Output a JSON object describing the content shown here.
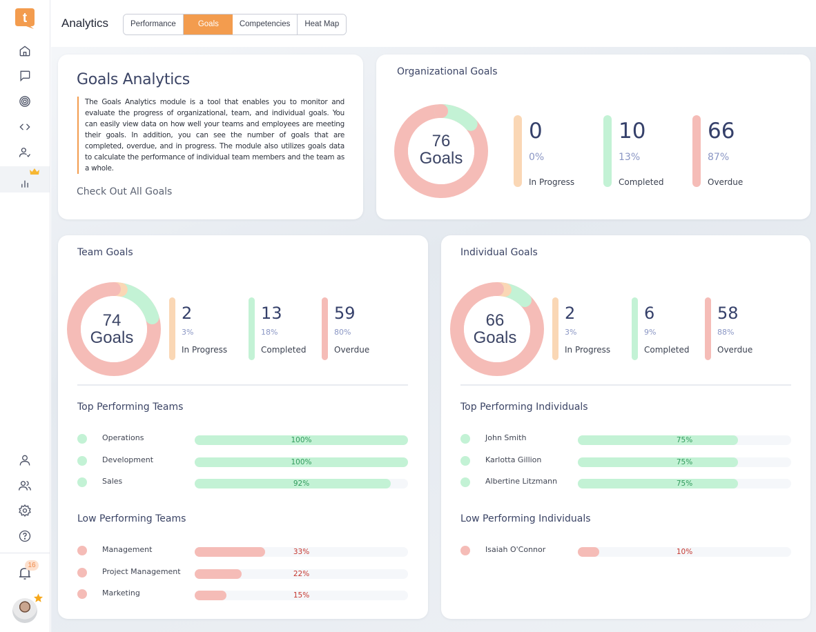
{
  "app": {
    "logo_letter": "t",
    "header_title": "Analytics",
    "tabs": [
      {
        "label": "Performance",
        "active": false
      },
      {
        "label": "Goals",
        "active": true
      },
      {
        "label": "Competencies",
        "active": false
      },
      {
        "label": "Heat Map",
        "active": false
      }
    ],
    "notifications_count": "16"
  },
  "sidebar": {
    "items": [
      {
        "name": "home",
        "icon": "home-icon"
      },
      {
        "name": "chat",
        "icon": "chat-icon"
      },
      {
        "name": "goals",
        "icon": "target-icon"
      },
      {
        "name": "code",
        "icon": "code-icon"
      },
      {
        "name": "user-check",
        "icon": "user-check-icon"
      },
      {
        "name": "analytics",
        "icon": "bar-chart-icon",
        "active": true,
        "badge": "crown-icon"
      }
    ],
    "bottom_items": [
      {
        "name": "profile",
        "icon": "user-icon"
      },
      {
        "name": "people",
        "icon": "users-icon"
      },
      {
        "name": "settings",
        "icon": "gear-icon"
      },
      {
        "name": "help",
        "icon": "help-icon"
      }
    ]
  },
  "colors": {
    "accent": "#f39c4e",
    "in_progress": "#fad7b5",
    "completed": "#c3f2d5",
    "overdue": "#f5bcb7",
    "number": "#35406a",
    "percent": "#8a96c4"
  },
  "intro": {
    "title": "Goals Analytics",
    "description": "The Goals Analytics module is a tool that enables you to monitor and evaluate the progress of organizational, team, and individual goals. You can easily view data on how well your teams and employees are meeting their goals. In addition, you can see the number of goals that are completed, overdue, and in progress. The module also utilizes goals data to calculate the performance of individual team members and the team as a whole.",
    "link": "Check Out All Goals"
  },
  "org": {
    "title": "Organizational Goals",
    "total": "76",
    "total_label": "Goals",
    "stats": [
      {
        "key": "in_progress",
        "value": 0,
        "display": "0",
        "percent": "0%",
        "label": "In Progress"
      },
      {
        "key": "completed",
        "value": 10,
        "display": "10",
        "percent": "13%",
        "label": "Completed"
      },
      {
        "key": "overdue",
        "value": 66,
        "display": "66",
        "percent": "87%",
        "label": "Overdue"
      }
    ]
  },
  "team": {
    "title": "Team Goals",
    "total": "74",
    "total_label": "Goals",
    "stats": [
      {
        "key": "in_progress",
        "value": 2,
        "display": "2",
        "percent": "3%",
        "label": "In Progress"
      },
      {
        "key": "completed",
        "value": 13,
        "display": "13",
        "percent": "18%",
        "label": "Completed"
      },
      {
        "key": "overdue",
        "value": 59,
        "display": "59",
        "percent": "80%",
        "label": "Overdue"
      }
    ],
    "top_title": "Top Performing Teams",
    "top": [
      {
        "name": "Operations",
        "value": 100,
        "label": "100%"
      },
      {
        "name": "Development",
        "value": 100,
        "label": "100%"
      },
      {
        "name": "Sales",
        "value": 92,
        "label": "92%"
      }
    ],
    "low_title": "Low Performing Teams",
    "low": [
      {
        "name": "Management",
        "value": 33,
        "label": "33%"
      },
      {
        "name": "Project Management",
        "value": 22,
        "label": "22%"
      },
      {
        "name": "Marketing",
        "value": 15,
        "label": "15%"
      }
    ]
  },
  "indiv": {
    "title": "Individual Goals",
    "total": "66",
    "total_label": "Goals",
    "stats": [
      {
        "key": "in_progress",
        "value": 2,
        "display": "2",
        "percent": "3%",
        "label": "In Progress"
      },
      {
        "key": "completed",
        "value": 6,
        "display": "6",
        "percent": "9%",
        "label": "Completed"
      },
      {
        "key": "overdue",
        "value": 58,
        "display": "58",
        "percent": "88%",
        "label": "Overdue"
      }
    ],
    "top_title": "Top Performing Individuals",
    "top": [
      {
        "name": "John Smith",
        "value": 75,
        "label": "75%"
      },
      {
        "name": "Karlotta Gillion",
        "value": 75,
        "label": "75%"
      },
      {
        "name": "Albertine Litzmann",
        "value": 75,
        "label": "75%"
      }
    ],
    "low_title": "Low Performing Individuals",
    "low": [
      {
        "name": "Isaiah O'Connor",
        "value": 10,
        "label": "10%"
      }
    ]
  }
}
